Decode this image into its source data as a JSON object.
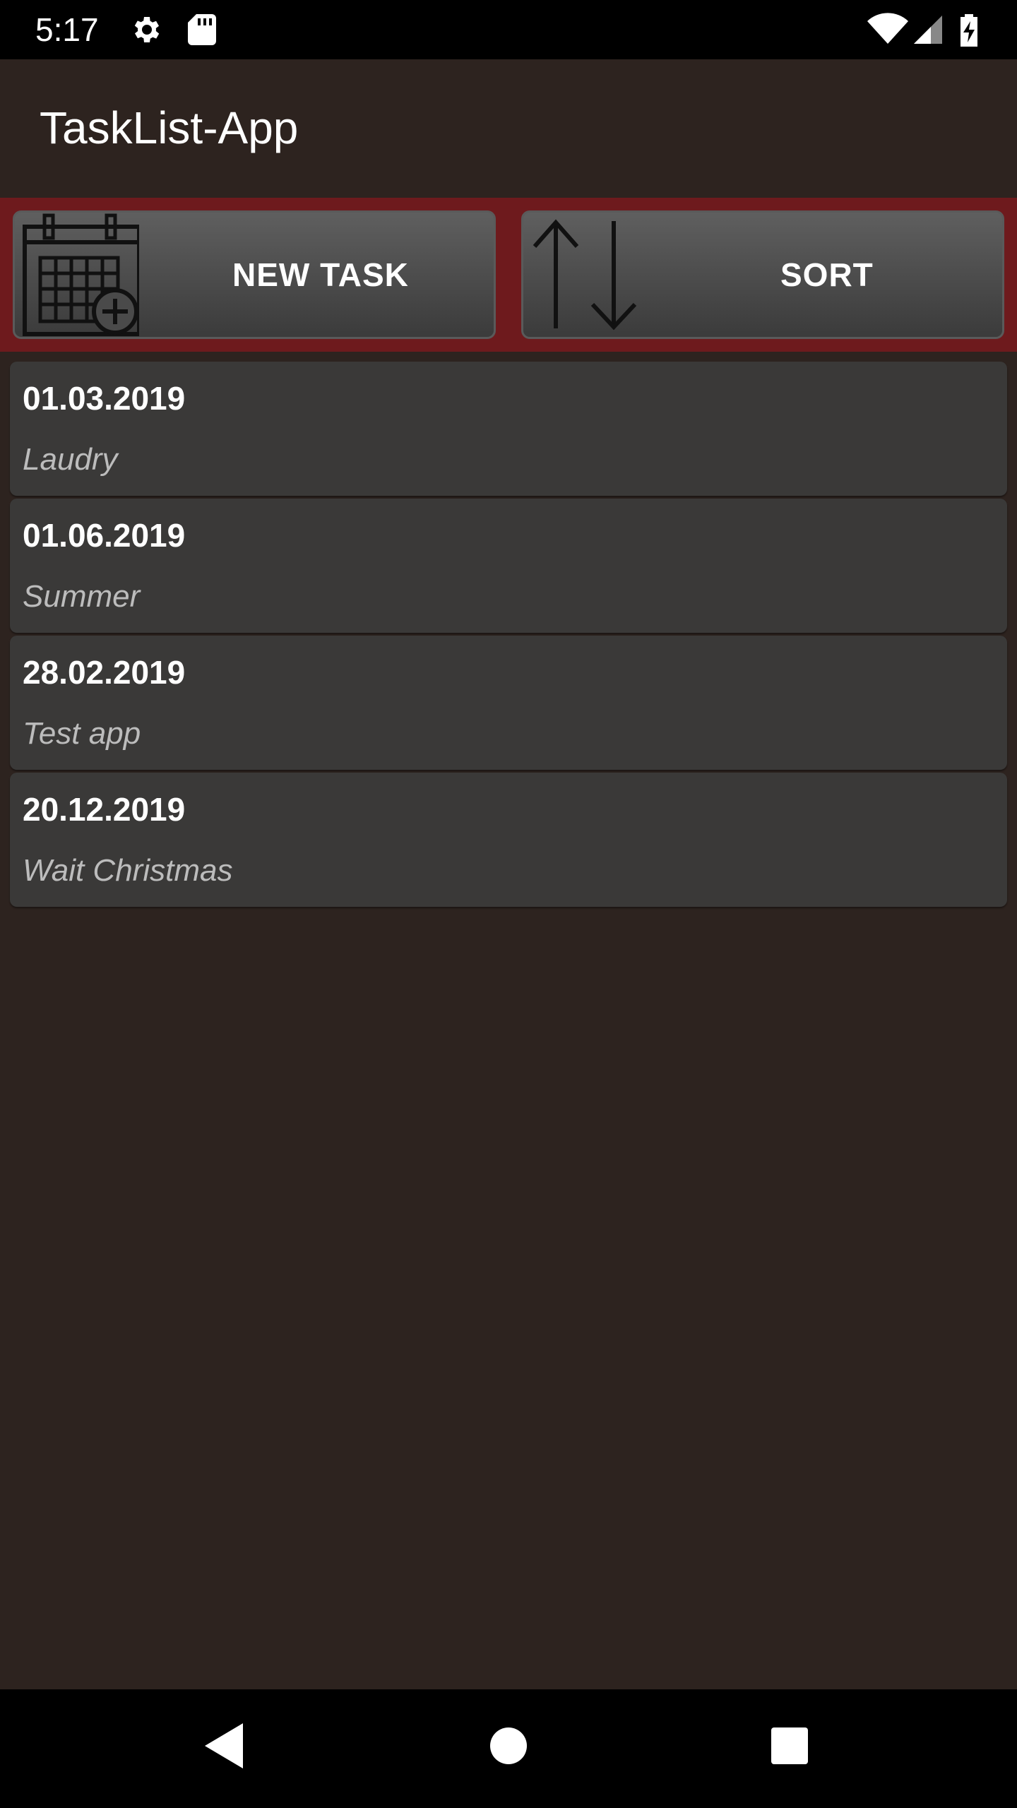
{
  "status_bar": {
    "time": "5:17",
    "icons": [
      "gear-icon",
      "sd-card-icon",
      "wifi-icon",
      "signal-icon",
      "battery-charging-icon"
    ]
  },
  "app_bar": {
    "title": "TaskList-App"
  },
  "toolbar": {
    "new_task_label": "NEW TASK",
    "new_task_icon": "calendar-add-icon",
    "sort_label": "SORT",
    "sort_icon": "sort-arrows-icon"
  },
  "tasks": [
    {
      "date": "01.03.2019",
      "name": "Laudry"
    },
    {
      "date": "01.06.2019",
      "name": "Summer"
    },
    {
      "date": "28.02.2019",
      "name": "Test app"
    },
    {
      "date": "20.12.2019",
      "name": "Wait Christmas"
    }
  ],
  "nav_bar": {
    "icons": [
      "back-icon",
      "home-icon",
      "recents-icon"
    ]
  },
  "colors": {
    "background": "#2d231f",
    "toolbar_accent": "#6e1a1d",
    "card": "#3a3938",
    "status_bar": "#000000"
  }
}
